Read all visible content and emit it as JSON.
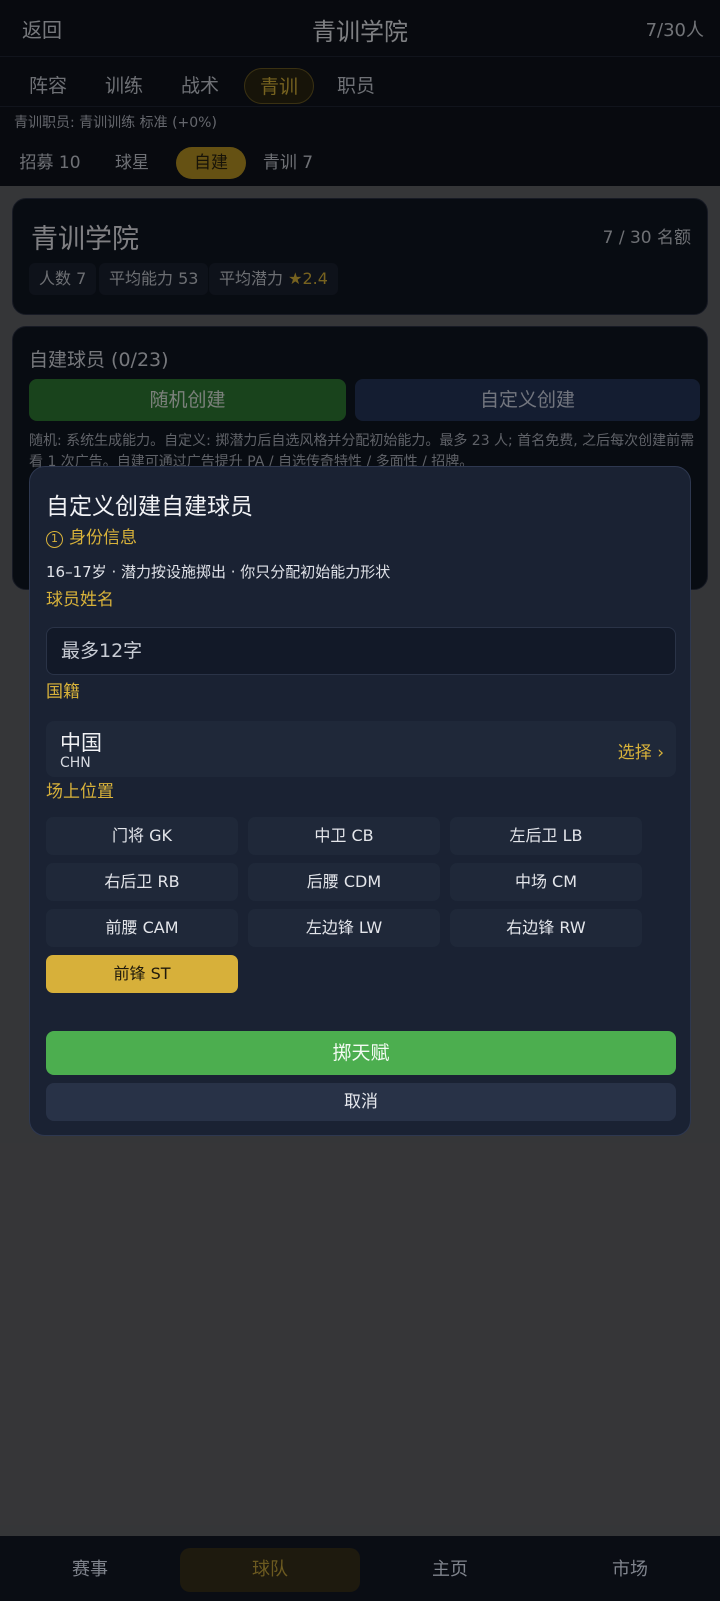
{
  "header": {
    "back": "返回",
    "title": "青训学院",
    "count": "7/30人"
  },
  "tabs": [
    {
      "label": "阵容"
    },
    {
      "label": "训练"
    },
    {
      "label": "战术"
    },
    {
      "label": "青训",
      "active": true
    },
    {
      "label": "职员"
    }
  ],
  "staff_line": "青训职员: 青训训练 标准 (+0%)",
  "subtabs": [
    {
      "label": "招募 10"
    },
    {
      "label": "球星"
    },
    {
      "label": "自建",
      "active": true
    },
    {
      "label": "青训 7"
    }
  ],
  "academy_card": {
    "title": "青训学院",
    "quota": "7 / 30 名额",
    "chips": {
      "members": "人数 7",
      "avg_ability": "平均能力 53",
      "avg_potential_label": "平均潜力",
      "avg_potential_star": "★",
      "avg_potential_value": "2.4"
    }
  },
  "custom_card": {
    "title": "自建球员 (0/23)",
    "random_btn": "随机创建",
    "custom_btn": "自定义创建",
    "desc": "随机: 系统生成能力。自定义: 掷潜力后自选风格并分配初始能力。最多 23 人; 首名免费, 之后每次创建前需看 1 次广告。自建可通过广告提升 PA / 自选传奇特性 / 多面性 / 招牌。"
  },
  "modal": {
    "title": "自定义创建自建球员",
    "section_num": "1",
    "section": "身份信息",
    "note": "16–17岁 · 潜力按设施掷出 · 你只分配初始能力形状",
    "name_label": "球员姓名",
    "name_placeholder": "最多12字",
    "nation_label": "国籍",
    "nation_name": "中国",
    "nation_code": "CHN",
    "nation_select": "选择 ›",
    "position_label": "场上位置",
    "positions": [
      {
        "label": "门将 GK"
      },
      {
        "label": "中卫 CB"
      },
      {
        "label": "左后卫 LB"
      },
      {
        "label": "右后卫 RB"
      },
      {
        "label": "后腰 CDM"
      },
      {
        "label": "中场 CM"
      },
      {
        "label": "前腰 CAM"
      },
      {
        "label": "左边锋 LW"
      },
      {
        "label": "右边锋 RW"
      },
      {
        "label": "前锋 ST",
        "selected": true
      }
    ],
    "roll_btn": "掷天赋",
    "cancel_btn": "取消"
  },
  "bottom_nav": [
    {
      "label": "赛事"
    },
    {
      "label": "球队",
      "active": true
    },
    {
      "label": "主页"
    },
    {
      "label": "市场"
    }
  ],
  "colors": {
    "accent": "#d8b23a",
    "green": "#4cae4f",
    "background": "#1a2233"
  }
}
